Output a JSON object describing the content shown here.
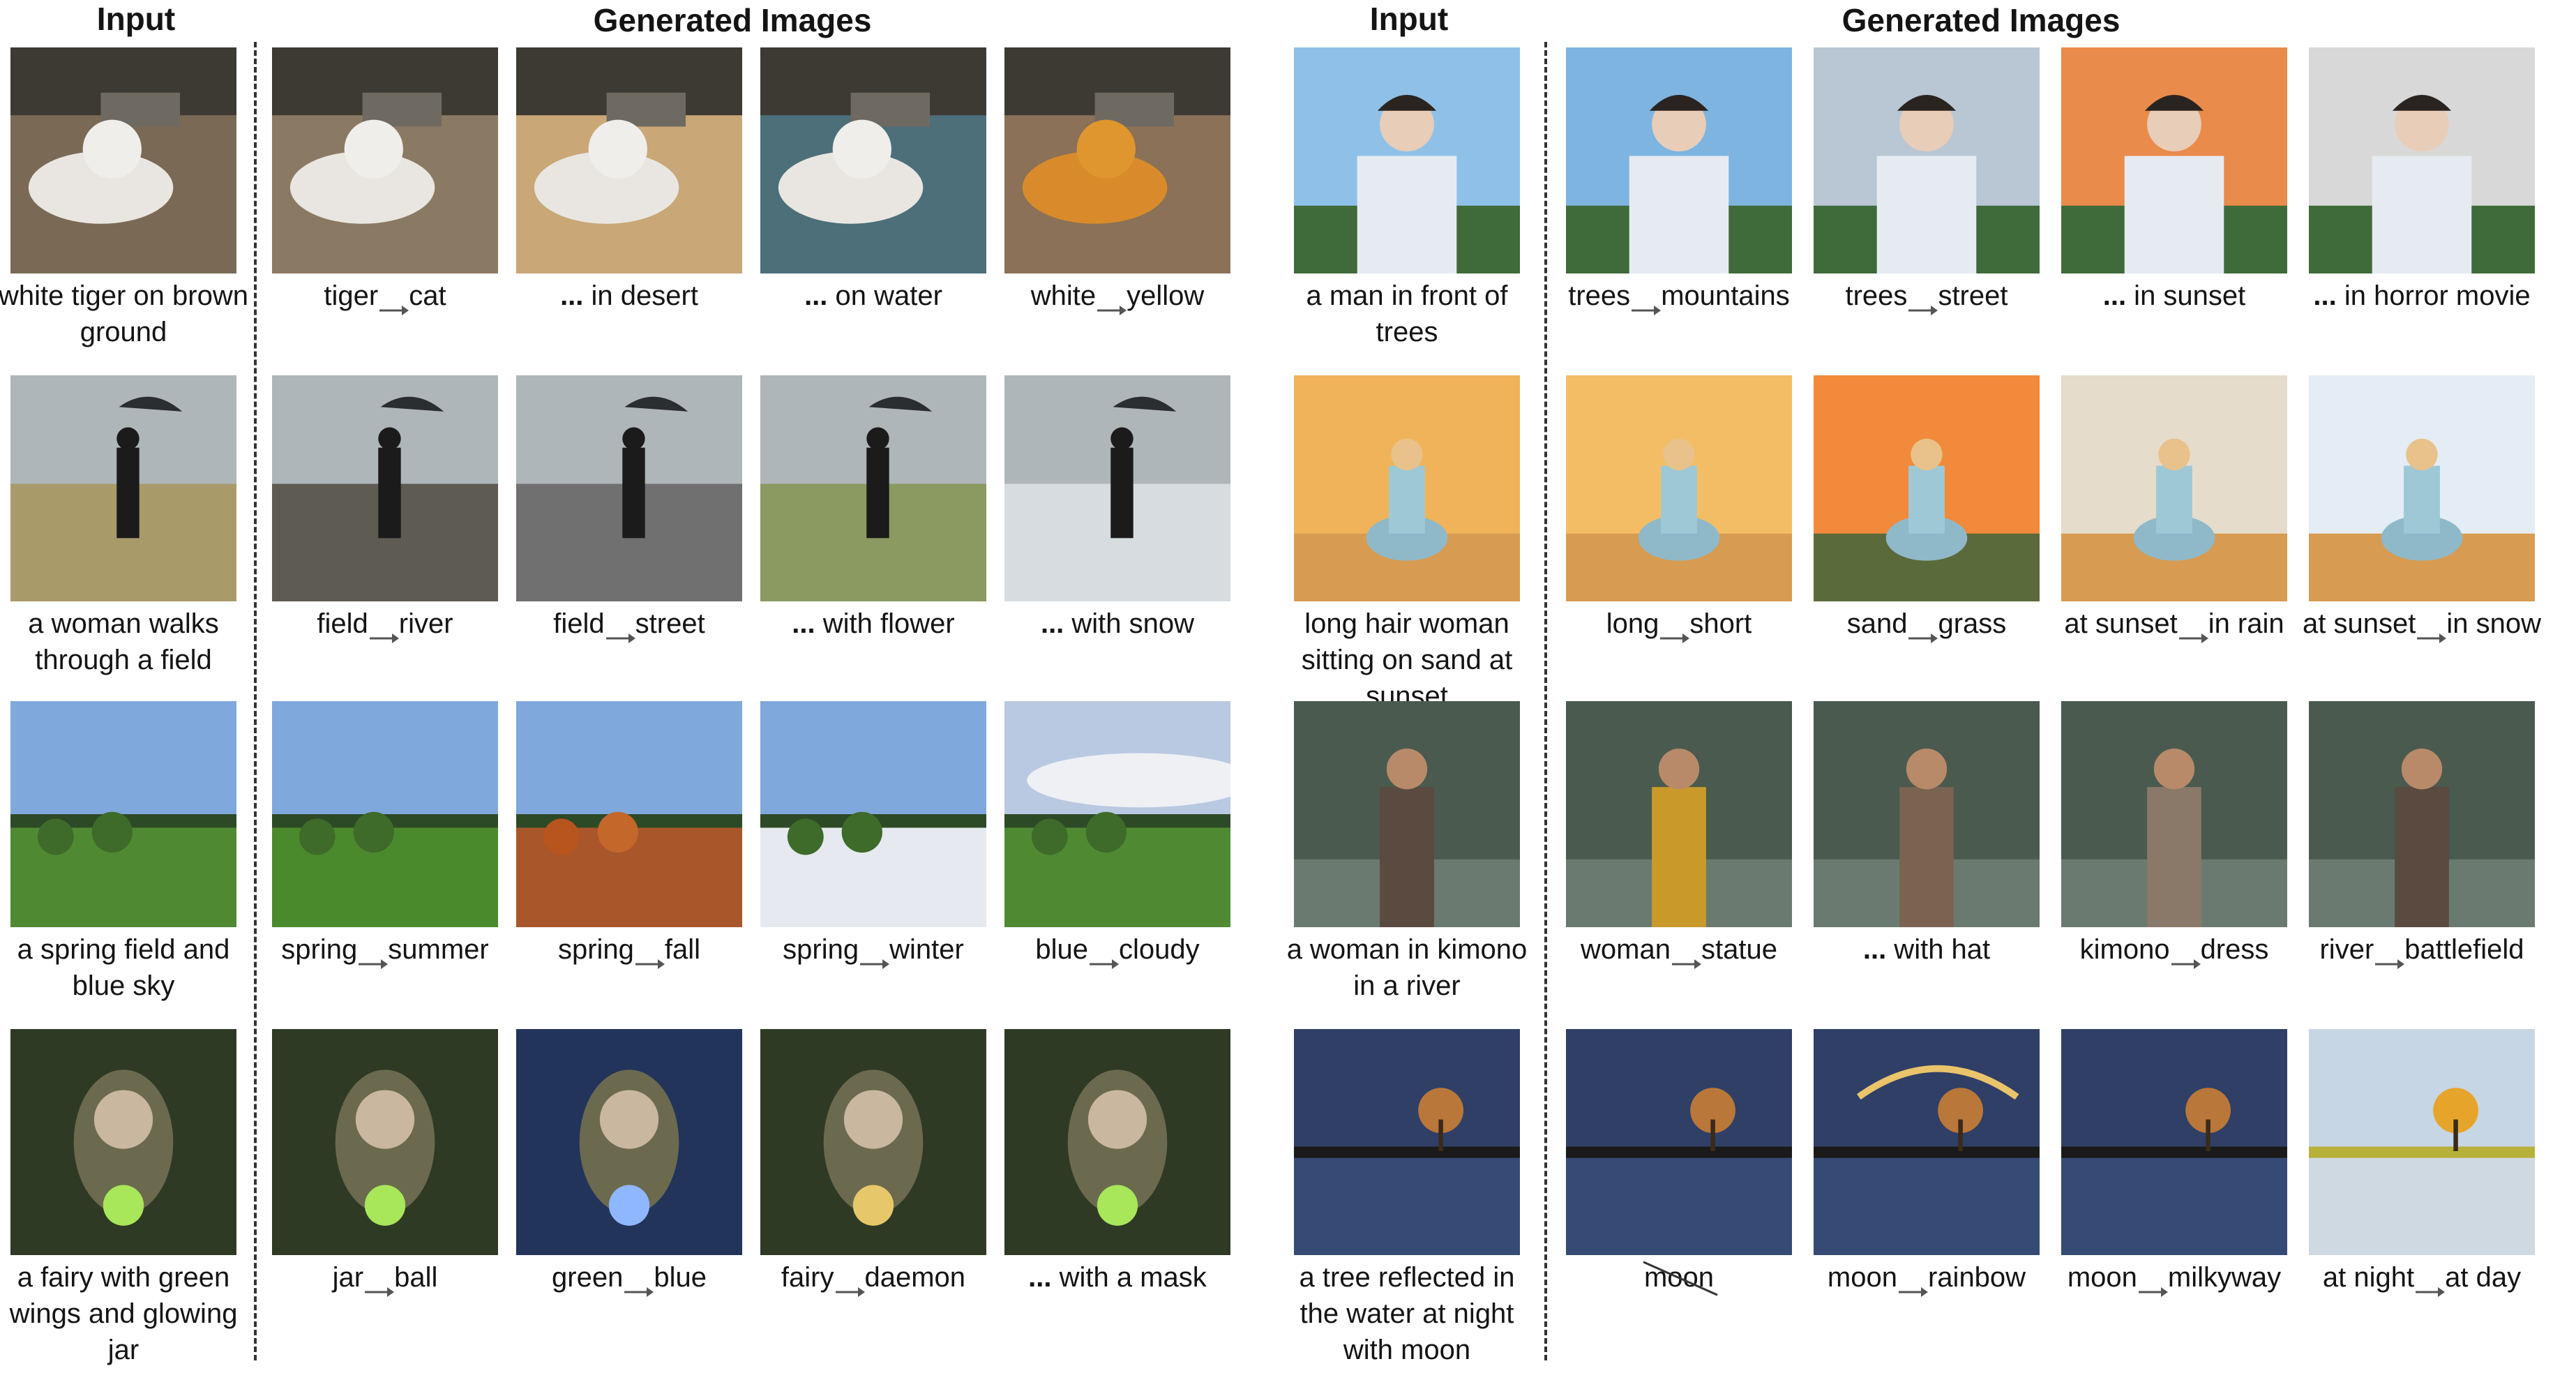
{
  "headers": {
    "left_input": "Input",
    "left_generated": "Generated Images",
    "right_input": "Input",
    "right_generated": "Generated Images"
  },
  "colors": {
    "ink": "#141414",
    "divider": "#333333",
    "background": "#ffffff"
  },
  "rows": [
    {
      "input_caption": "white tiger on brown ground",
      "edits": [
        {
          "from": "tiger",
          "to": "cat"
        },
        {
          "from": "...",
          "to": "in desert"
        },
        {
          "from": "...",
          "to": "on water"
        },
        {
          "from": "white",
          "to": "yellow"
        }
      ],
      "right_input_caption": "a man in front of trees",
      "right_edits": [
        {
          "from": "trees",
          "to": "mountains"
        },
        {
          "from": "trees",
          "to": "street"
        },
        {
          "from": "...",
          "to": "in sunset"
        },
        {
          "from": "...",
          "to": "in horror movie"
        }
      ]
    },
    {
      "input_caption": "a woman walks through a field",
      "edits": [
        {
          "from": "field",
          "to": "river"
        },
        {
          "from": "field",
          "to": "street"
        },
        {
          "from": "...",
          "to": "with flower"
        },
        {
          "from": "...",
          "to": "with snow"
        }
      ],
      "right_input_caption": "long hair woman sitting on sand at sunset",
      "right_edits": [
        {
          "from": "long",
          "to": "short"
        },
        {
          "from": "sand",
          "to": "grass"
        },
        {
          "from": "at sunset",
          "to": "in rain"
        },
        {
          "from": "at sunset",
          "to": "in snow"
        }
      ]
    },
    {
      "input_caption": "a spring field and blue sky",
      "edits": [
        {
          "from": "spring",
          "to": "summer"
        },
        {
          "from": "spring",
          "to": "fall"
        },
        {
          "from": "spring",
          "to": "winter"
        },
        {
          "from": "blue",
          "to": "cloudy"
        }
      ],
      "right_input_caption": "a woman in kimono in a river",
      "right_edits": [
        {
          "from": "woman",
          "to": "statue"
        },
        {
          "from": "...",
          "to": "with hat"
        },
        {
          "from": "kimono",
          "to": "dress"
        },
        {
          "from": "river",
          "to": "battlefield"
        }
      ]
    },
    {
      "input_caption": "a fairy with green wings and glowing jar",
      "edits": [
        {
          "from": "jar",
          "to": "ball"
        },
        {
          "from": "green",
          "to": "blue"
        },
        {
          "from": "fairy",
          "to": "daemon"
        },
        {
          "from": "...",
          "to": "with a mask"
        }
      ],
      "right_input_caption": "a tree reflected in the water at night with moon",
      "right_edits": [
        {
          "from": "moon",
          "to": ""
        },
        {
          "from": "moon",
          "to": "rainbow"
        },
        {
          "from": "moon",
          "to": "milkyway"
        },
        {
          "from": "at night",
          "to": "at day"
        }
      ]
    }
  ]
}
